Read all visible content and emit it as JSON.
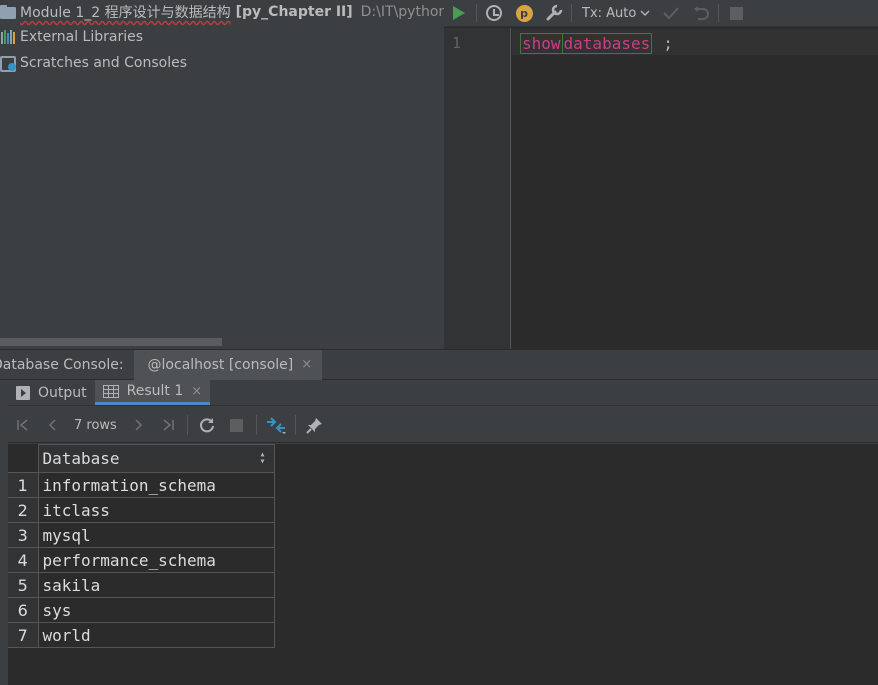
{
  "project_tree": {
    "module": {
      "name": "Module 1_2 程序设计与数据结构",
      "bold": "[py_Chapter II]",
      "path": "D:\\IT\\python B"
    },
    "items": [
      {
        "label": "External Libraries",
        "icon": "library-icon"
      },
      {
        "label": "Scratches and Consoles",
        "icon": "scratch-icon"
      }
    ]
  },
  "toolbar": {
    "tx_label": "Tx: Auto"
  },
  "editor": {
    "line_number": "1",
    "keyword_1": "show",
    "keyword_2": "databases",
    "terminator": ";"
  },
  "console_tabs": {
    "label": "Database Console:",
    "tab": "@localhost [console]",
    "close": "×"
  },
  "result_tabs": {
    "output": "Output",
    "result": "Result 1",
    "close": "×"
  },
  "result_toolbar": {
    "rows": "7 rows"
  },
  "table": {
    "column": "Database",
    "rows": [
      {
        "n": "1",
        "v": "information_schema"
      },
      {
        "n": "2",
        "v": "itclass"
      },
      {
        "n": "3",
        "v": "mysql"
      },
      {
        "n": "4",
        "v": "performance_schema"
      },
      {
        "n": "5",
        "v": "sakila"
      },
      {
        "n": "6",
        "v": "sys"
      },
      {
        "n": "7",
        "v": "world"
      }
    ]
  },
  "colors": {
    "keyword": "#cc3d87",
    "run_green": "#499c54",
    "selected_tab_underline": "#4a88c7"
  }
}
